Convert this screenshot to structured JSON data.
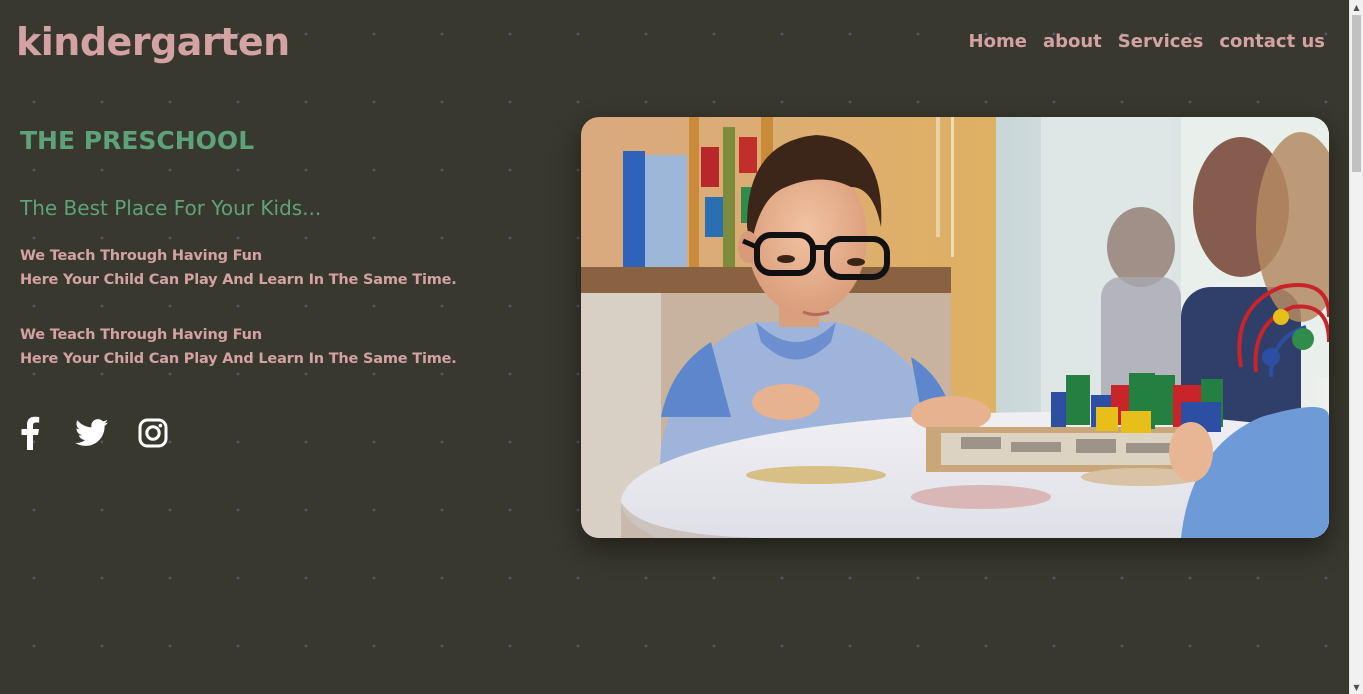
{
  "header": {
    "logo": "kindergarten",
    "nav": [
      {
        "label": "Home"
      },
      {
        "label": "about"
      },
      {
        "label": "Services"
      },
      {
        "label": "contact us"
      }
    ]
  },
  "hero": {
    "title": "THE PRESCHOOL",
    "subtitle": "The Best Place For Your Kids...",
    "paragraphs": [
      {
        "line1": "We Teach Through Having Fun",
        "line2": "Here Your Child Can Play And Learn In The Same Time."
      },
      {
        "line1": "We Teach Through Having Fun",
        "line2": "Here Your Child Can Play And Learn In The Same Time."
      }
    ],
    "social": [
      {
        "icon": "facebook-icon"
      },
      {
        "icon": "twitter-icon"
      },
      {
        "icon": "instagram-icon"
      }
    ],
    "image_description_icon": "child-playing-puzzle-photo"
  },
  "colors": {
    "background": "#38382e",
    "accent_pink": "#d3a2a2",
    "accent_green": "#5ea27a",
    "icon_white": "#ffffff"
  },
  "scrollbar": {
    "position_fraction": 0.0
  }
}
